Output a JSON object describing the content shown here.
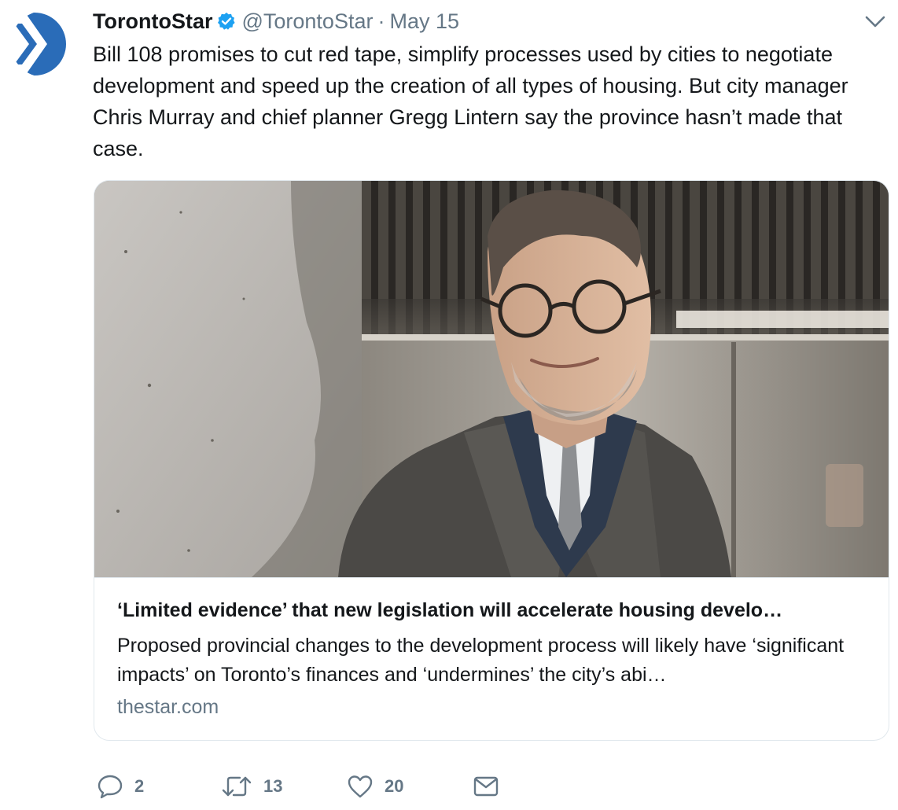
{
  "tweet": {
    "display_name": "TorontoStar",
    "handle": "@TorontoStar",
    "separator": "·",
    "date": "May 15",
    "text": "Bill 108 promises to cut red tape, simplify processes used by cities to negotiate development and speed up the creation of all types of housing. But city manager Chris Murray and chief planner Gregg Lintern say the province hasn’t made that case."
  },
  "card": {
    "title": "‘Limited evidence’ that new legislation will accelerate housing develo…",
    "description": "Proposed provincial changes to the development process will likely have ‘significant impacts’ on Toronto’s finances and ‘undermines’ the city’s abi…",
    "domain": "thestar.com"
  },
  "actions": {
    "reply_count": "2",
    "retweet_count": "13",
    "like_count": "20"
  },
  "icons": {
    "avatar": "toronto-star-logo",
    "verified": "verified-badge-icon",
    "caret": "chevron-down-icon",
    "reply": "reply-icon",
    "retweet": "retweet-icon",
    "like": "heart-icon",
    "message": "envelope-icon"
  },
  "colors": {
    "text": "#14171a",
    "secondary": "#657786",
    "verified": "#1da1f2",
    "brand_blue": "#2a6cb8",
    "card_border": "#e1e8ed"
  }
}
